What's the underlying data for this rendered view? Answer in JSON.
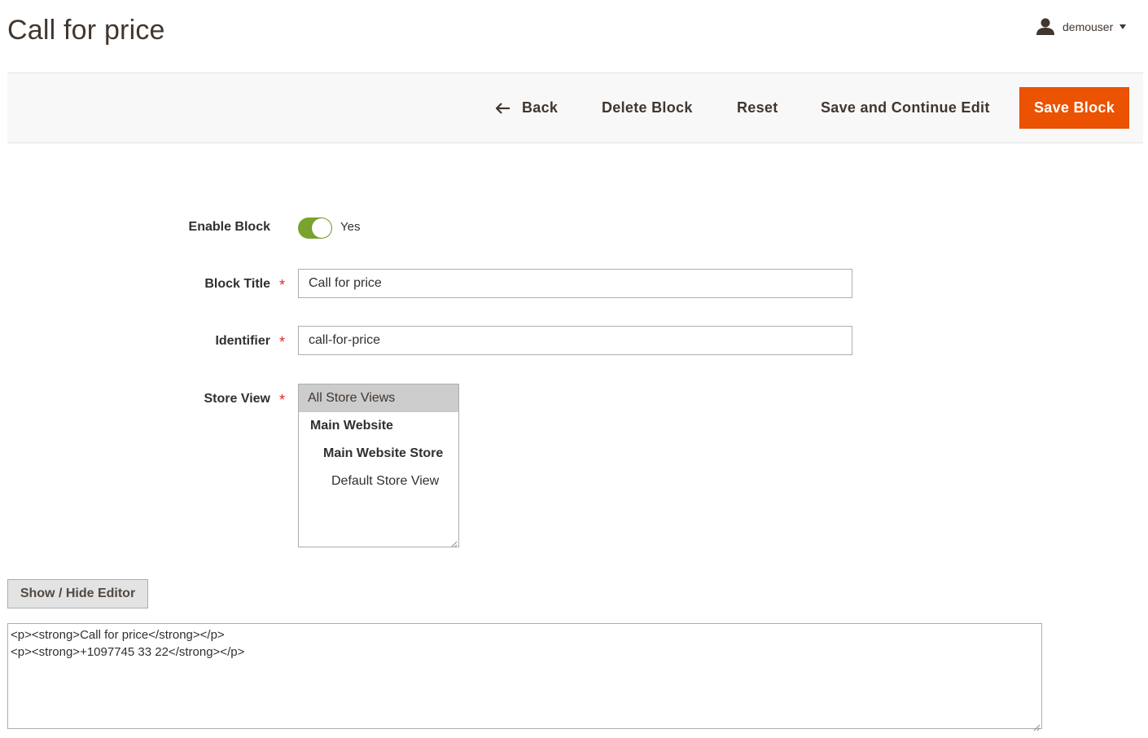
{
  "header": {
    "page_title": "Call for price",
    "user": {
      "name": "demouser",
      "icon": "user-icon"
    }
  },
  "actions": {
    "back_label": "Back",
    "delete_label": "Delete Block",
    "reset_label": "Reset",
    "save_continue_label": "Save and Continue Edit",
    "save_label": "Save Block"
  },
  "form": {
    "enable_block": {
      "label": "Enable Block",
      "value_label": "Yes",
      "enabled": true
    },
    "block_title": {
      "label": "Block Title",
      "required_mark": "*",
      "value": "Call for price"
    },
    "identifier": {
      "label": "Identifier",
      "required_mark": "*",
      "value": "call-for-price"
    },
    "store_view": {
      "label": "Store View",
      "required_mark": "*",
      "options": [
        {
          "label": "All Store Views",
          "selected": true
        },
        {
          "label": "Main Website"
        },
        {
          "label": "Main Website Store"
        },
        {
          "label": "Default Store View"
        }
      ]
    }
  },
  "editor": {
    "toggle_label": "Show / Hide Editor",
    "content": "<p><strong>Call for price</strong></p>\n<p><strong>+1097745 33 22</strong></p>"
  },
  "colors": {
    "primary_button": "#eb5202",
    "toggle_on": "#79a22e",
    "required": "#e22626"
  }
}
